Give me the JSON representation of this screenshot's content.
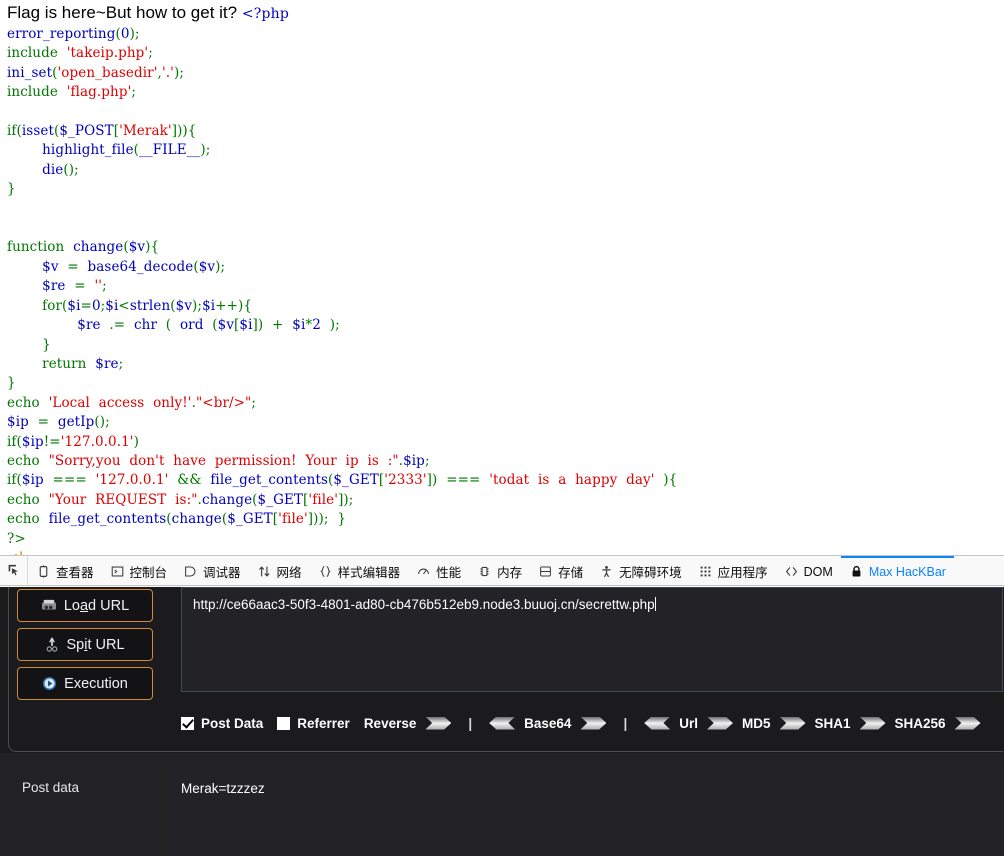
{
  "page": {
    "headline": "Flag is here~But how to get it?",
    "php_open": "<?php",
    "code_lines": [
      [
        {
          "t": "error_reporting",
          "c": "fn"
        },
        {
          "t": "(",
          "c": "kw"
        },
        {
          "t": "0",
          "c": "fn"
        },
        {
          "t": ");",
          "c": "kw"
        }
      ],
      [
        {
          "t": "include  ",
          "c": "kw"
        },
        {
          "t": "'takeip.php'",
          "c": "str"
        },
        {
          "t": ";",
          "c": "kw"
        }
      ],
      [
        {
          "t": "ini_set",
          "c": "fn"
        },
        {
          "t": "(",
          "c": "kw"
        },
        {
          "t": "'open_basedir'",
          "c": "str"
        },
        {
          "t": ",",
          "c": "kw"
        },
        {
          "t": "'.'",
          "c": "str"
        },
        {
          "t": ");",
          "c": "kw"
        }
      ],
      [
        {
          "t": "include  ",
          "c": "kw"
        },
        {
          "t": "'flag.php'",
          "c": "str"
        },
        {
          "t": ";",
          "c": "kw"
        }
      ],
      [],
      [
        {
          "t": "if",
          "c": "kw"
        },
        {
          "t": "(",
          "c": "kw"
        },
        {
          "t": "isset",
          "c": "fn"
        },
        {
          "t": "(",
          "c": "kw"
        },
        {
          "t": "$_POST",
          "c": "fn"
        },
        {
          "t": "[",
          "c": "kw"
        },
        {
          "t": "'Merak'",
          "c": "str"
        },
        {
          "t": "])){",
          "c": "kw"
        }
      ],
      [
        {
          "t": "        ",
          "c": "kw"
        },
        {
          "t": "highlight_file",
          "c": "fn"
        },
        {
          "t": "(",
          "c": "kw"
        },
        {
          "t": "__FILE__",
          "c": "fn"
        },
        {
          "t": ");",
          "c": "kw"
        }
      ],
      [
        {
          "t": "        ",
          "c": "kw"
        },
        {
          "t": "die",
          "c": "fn"
        },
        {
          "t": "();",
          "c": "kw"
        }
      ],
      [
        {
          "t": "}",
          "c": "kw"
        }
      ],
      [],
      [],
      [
        {
          "t": "function  ",
          "c": "kw"
        },
        {
          "t": "change",
          "c": "fn"
        },
        {
          "t": "(",
          "c": "kw"
        },
        {
          "t": "$v",
          "c": "fn"
        },
        {
          "t": "){",
          "c": "kw"
        }
      ],
      [
        {
          "t": "        ",
          "c": "kw"
        },
        {
          "t": "$v",
          "c": "fn"
        },
        {
          "t": "  =  ",
          "c": "kw"
        },
        {
          "t": "base64_decode",
          "c": "fn"
        },
        {
          "t": "(",
          "c": "kw"
        },
        {
          "t": "$v",
          "c": "fn"
        },
        {
          "t": ");",
          "c": "kw"
        }
      ],
      [
        {
          "t": "        ",
          "c": "kw"
        },
        {
          "t": "$re",
          "c": "fn"
        },
        {
          "t": "  =  ",
          "c": "kw"
        },
        {
          "t": "''",
          "c": "str"
        },
        {
          "t": ";",
          "c": "kw"
        }
      ],
      [
        {
          "t": "        ",
          "c": "kw"
        },
        {
          "t": "for",
          "c": "kw"
        },
        {
          "t": "(",
          "c": "kw"
        },
        {
          "t": "$i",
          "c": "fn"
        },
        {
          "t": "=",
          "c": "kw"
        },
        {
          "t": "0",
          "c": "fn"
        },
        {
          "t": ";",
          "c": "kw"
        },
        {
          "t": "$i",
          "c": "fn"
        },
        {
          "t": "<",
          "c": "kw"
        },
        {
          "t": "strlen",
          "c": "fn"
        },
        {
          "t": "(",
          "c": "kw"
        },
        {
          "t": "$v",
          "c": "fn"
        },
        {
          "t": ");",
          "c": "kw"
        },
        {
          "t": "$i",
          "c": "fn"
        },
        {
          "t": "++){",
          "c": "kw"
        }
      ],
      [
        {
          "t": "                ",
          "c": "kw"
        },
        {
          "t": "$re",
          "c": "fn"
        },
        {
          "t": "  .=  ",
          "c": "kw"
        },
        {
          "t": "chr",
          "c": "fn"
        },
        {
          "t": "  (  ",
          "c": "kw"
        },
        {
          "t": "ord",
          "c": "fn"
        },
        {
          "t": "  (",
          "c": "kw"
        },
        {
          "t": "$v",
          "c": "fn"
        },
        {
          "t": "[",
          "c": "kw"
        },
        {
          "t": "$i",
          "c": "fn"
        },
        {
          "t": "])  +  ",
          "c": "kw"
        },
        {
          "t": "$i",
          "c": "fn"
        },
        {
          "t": "*",
          "c": "kw"
        },
        {
          "t": "2",
          "c": "fn"
        },
        {
          "t": "  );",
          "c": "kw"
        }
      ],
      [
        {
          "t": "        }",
          "c": "kw"
        }
      ],
      [
        {
          "t": "        ",
          "c": "kw"
        },
        {
          "t": "return",
          "c": "kw"
        },
        {
          "t": "  ",
          "c": "kw"
        },
        {
          "t": "$re",
          "c": "fn"
        },
        {
          "t": ";",
          "c": "kw"
        }
      ],
      [
        {
          "t": "}",
          "c": "kw"
        }
      ],
      [
        {
          "t": "echo  ",
          "c": "kw"
        },
        {
          "t": "'Local  access  only!'",
          "c": "str"
        },
        {
          "t": ".",
          "c": "kw"
        },
        {
          "t": "\"<br/>\"",
          "c": "str"
        },
        {
          "t": ";",
          "c": "kw"
        }
      ],
      [
        {
          "t": "$ip",
          "c": "fn"
        },
        {
          "t": "  =  ",
          "c": "kw"
        },
        {
          "t": "getIp",
          "c": "fn"
        },
        {
          "t": "();",
          "c": "kw"
        }
      ],
      [
        {
          "t": "if",
          "c": "kw"
        },
        {
          "t": "(",
          "c": "kw"
        },
        {
          "t": "$ip",
          "c": "fn"
        },
        {
          "t": "!=",
          "c": "kw"
        },
        {
          "t": "'127.0.0.1'",
          "c": "str"
        },
        {
          "t": ")",
          "c": "kw"
        }
      ],
      [
        {
          "t": "echo  ",
          "c": "kw"
        },
        {
          "t": "\"Sorry,you  don't  have  permission!  Your  ip  is  :\"",
          "c": "str"
        },
        {
          "t": ".",
          "c": "kw"
        },
        {
          "t": "$ip",
          "c": "fn"
        },
        {
          "t": ";",
          "c": "kw"
        }
      ],
      [
        {
          "t": "if",
          "c": "kw"
        },
        {
          "t": "(",
          "c": "kw"
        },
        {
          "t": "$ip",
          "c": "fn"
        },
        {
          "t": "  ===  ",
          "c": "kw"
        },
        {
          "t": "'127.0.0.1'",
          "c": "str"
        },
        {
          "t": "  &&  ",
          "c": "kw"
        },
        {
          "t": "file_get_contents",
          "c": "fn"
        },
        {
          "t": "(",
          "c": "kw"
        },
        {
          "t": "$_GET",
          "c": "fn"
        },
        {
          "t": "[",
          "c": "kw"
        },
        {
          "t": "'2333'",
          "c": "str"
        },
        {
          "t": "])  ===  ",
          "c": "kw"
        },
        {
          "t": "'todat  is  a  happy  day'",
          "c": "str"
        },
        {
          "t": "  ){",
          "c": "kw"
        }
      ],
      [
        {
          "t": "echo  ",
          "c": "kw"
        },
        {
          "t": "\"Your  REQUEST  is:\"",
          "c": "str"
        },
        {
          "t": ".",
          "c": "kw"
        },
        {
          "t": "change",
          "c": "fn"
        },
        {
          "t": "(",
          "c": "kw"
        },
        {
          "t": "$_GET",
          "c": "fn"
        },
        {
          "t": "[",
          "c": "kw"
        },
        {
          "t": "'file'",
          "c": "str"
        },
        {
          "t": "]);",
          "c": "kw"
        }
      ],
      [
        {
          "t": "echo  ",
          "c": "kw"
        },
        {
          "t": "file_get_contents",
          "c": "fn"
        },
        {
          "t": "(",
          "c": "kw"
        },
        {
          "t": "change",
          "c": "fn"
        },
        {
          "t": "(",
          "c": "kw"
        },
        {
          "t": "$_GET",
          "c": "fn"
        },
        {
          "t": "[",
          "c": "kw"
        },
        {
          "t": "'file'",
          "c": "str"
        },
        {
          "t": "]));  }",
          "c": "kw"
        }
      ],
      [
        {
          "t": "?>",
          "c": "kw"
        }
      ],
      [
        {
          "t": "<!--",
          "c": "cmt"
        }
      ]
    ]
  },
  "devtools": {
    "picker_icon": "element-picker-icon",
    "tabs": [
      {
        "label": "查看器",
        "icon": "inspector-icon",
        "active": false
      },
      {
        "label": "控制台",
        "icon": "console-icon",
        "active": false
      },
      {
        "label": "调试器",
        "icon": "debugger-icon",
        "active": false
      },
      {
        "label": "网络",
        "icon": "network-icon",
        "active": false
      },
      {
        "label": "样式编辑器",
        "icon": "style-editor-icon",
        "active": false
      },
      {
        "label": "性能",
        "icon": "performance-icon",
        "active": false
      },
      {
        "label": "内存",
        "icon": "memory-icon",
        "active": false
      },
      {
        "label": "存储",
        "icon": "storage-icon",
        "active": false
      },
      {
        "label": "无障碍环境",
        "icon": "accessibility-icon",
        "active": false
      },
      {
        "label": "应用程序",
        "icon": "application-icon",
        "active": false
      },
      {
        "label": "DOM",
        "icon": "dom-icon",
        "active": false
      },
      {
        "label": "Max HacKBar",
        "icon": "lock-icon",
        "active": true
      }
    ],
    "accent_color": "#0a84ff"
  },
  "hackbar": {
    "buttons": [
      {
        "label_pre": "Lo",
        "label_u": "a",
        "label_post": "d URL",
        "icon": "load-url-icon"
      },
      {
        "label_pre": "Sp",
        "label_u": "i",
        "label_post": "t URL",
        "icon": "split-url-icon"
      },
      {
        "label_pre": "Execution",
        "label_u": "",
        "label_post": "",
        "icon": "execution-icon"
      }
    ],
    "button_border_color": "#d08a3a",
    "url_value": "http://ce66aac3-50f3-4801-ad80-cb476b512eb9.node3.buuoj.cn/secrettw.php",
    "options": {
      "post_data_label": "Post Data",
      "post_data_checked": true,
      "referrer_label": "Referrer",
      "referrer_checked": false,
      "encoders": [
        {
          "label": "Reverse",
          "right": true,
          "left": true
        },
        {
          "label": "Base64",
          "right": true,
          "left": true
        },
        {
          "label": "Url",
          "right": true,
          "left": false
        },
        {
          "label": "MD5",
          "right": true,
          "left": false
        },
        {
          "label": "SHA1",
          "right": true,
          "left": false
        },
        {
          "label": "SHA256",
          "right": true,
          "left": false
        }
      ]
    },
    "post_data_field_label": "Post data",
    "post_data_value": "Merak=tzzzez"
  }
}
